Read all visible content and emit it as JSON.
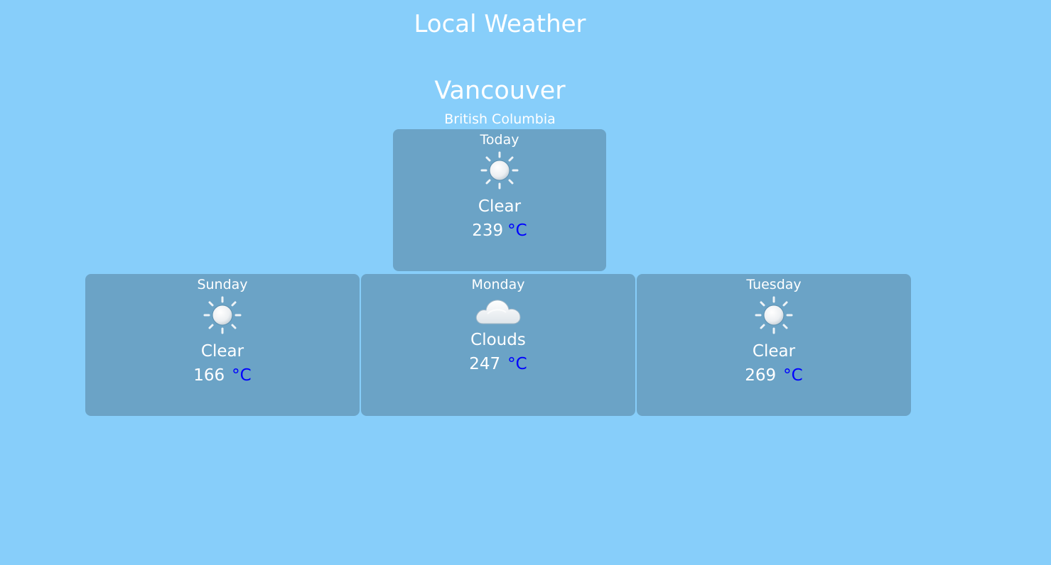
{
  "header": {
    "title": "Local Weather"
  },
  "location": {
    "city": "Vancouver",
    "region": "British Columbia"
  },
  "today": {
    "day": "Today",
    "icon": "sun-icon",
    "condition": "Clear",
    "temp": "239",
    "unit": "°C"
  },
  "forecast": [
    {
      "day": "Sunday",
      "icon": "sun-icon",
      "condition": "Clear",
      "temp": "166",
      "unit": "°C"
    },
    {
      "day": "Monday",
      "icon": "cloud-icon",
      "condition": "Clouds",
      "temp": "247",
      "unit": "°C"
    },
    {
      "day": "Tuesday",
      "icon": "sun-icon",
      "condition": "Clear",
      "temp": "269",
      "unit": "°C"
    }
  ],
  "colors": {
    "background": "#87cefa",
    "card": "#6ba3c6",
    "text": "#ffffff",
    "unit": "#0000ff"
  }
}
